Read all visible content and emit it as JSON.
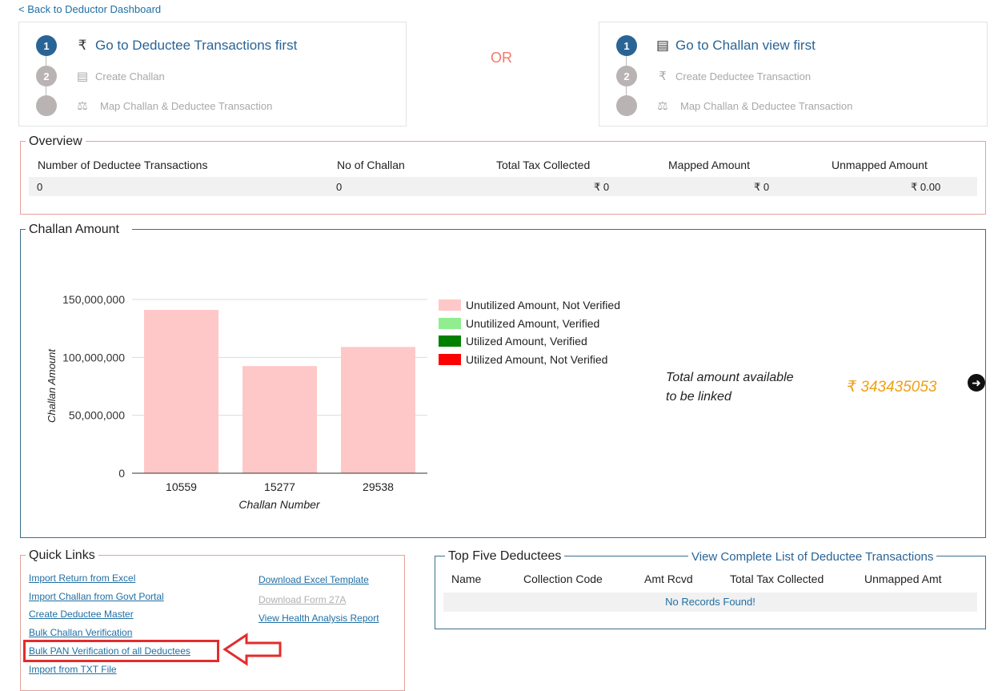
{
  "nav": {
    "back_label": "< Back to Deductor Dashboard"
  },
  "steps_left": {
    "title": "Go to Deductee Transactions first",
    "step1_num": "1",
    "step2_num": "2",
    "step2_label": "Create Challan",
    "step3_label": "Map Challan & Deductee Transaction"
  },
  "or_label": "OR",
  "steps_right": {
    "title": "Go to Challan view first",
    "step1_num": "1",
    "step2_num": "2",
    "step2_label": "Create Deductee Transaction",
    "step3_label": "Map Challan & Deductee Transaction"
  },
  "overview": {
    "legend": "Overview",
    "headers": [
      "Number of Deductee Transactions",
      "No of Challan",
      "Total Tax Collected",
      "Mapped Amount",
      "Unmapped Amount"
    ],
    "values": [
      "0",
      "0",
      "₹ 0",
      "₹ 0",
      "₹ 0.00"
    ]
  },
  "challan": {
    "legend": "Challan Amount",
    "total_label_line1": "Total amount available",
    "total_label_line2": "to be linked",
    "total_currency": "₹",
    "total_value": "343435053"
  },
  "chart_data": {
    "type": "bar",
    "categories": [
      "10559",
      "15277",
      "29538"
    ],
    "series": [
      {
        "name": "Unutilized Amount, Not Verified",
        "values": [
          141000000,
          92500000,
          109000000
        ],
        "color": "#ffc8c8"
      },
      {
        "name": "Unutilized Amount, Verified",
        "values": [
          0,
          0,
          0
        ],
        "color": "#90ee90"
      },
      {
        "name": "Utilized Amount, Verified",
        "values": [
          0,
          0,
          0
        ],
        "color": "#008000"
      },
      {
        "name": "Utilized Amount, Not Verified",
        "values": [
          0,
          0,
          0
        ],
        "color": "#ff0000"
      }
    ],
    "xlabel": "Challan Number",
    "ylabel": "Challan Amount",
    "ylim": [
      0,
      150000000
    ],
    "yticks": [
      0,
      50000000,
      100000000,
      150000000
    ],
    "ytick_labels": [
      "0",
      "50,000,000",
      "100,000,000",
      "150,000,000"
    ],
    "legend_position": "right",
    "grid": true
  },
  "quick_links": {
    "legend": "Quick Links",
    "left": [
      "Import Return from Excel",
      "Import Challan from Govt Portal",
      "Create Deductee Master",
      "Bulk Challan Verification",
      "Bulk PAN Verification of all Deductees",
      "Import from TXT File"
    ],
    "right": [
      "Download Excel Template",
      "Download Form 27A",
      "View Health Analysis Report"
    ]
  },
  "top_deductees": {
    "legend": "Top Five Deductees",
    "view_all": "View Complete List of Deductee Transactions",
    "headers": [
      "Name",
      "Collection Code",
      "Amt Rcvd",
      "Total Tax Collected",
      "Unmapped Amt"
    ],
    "empty": "No Records Found!"
  },
  "colors": {
    "accent": "#2a6496",
    "link": "#1f6fa3",
    "highlight": "#e32c2c",
    "overview_border": "#e6a19a",
    "challan_border": "#3b6f8c",
    "total": "#f0a016"
  }
}
